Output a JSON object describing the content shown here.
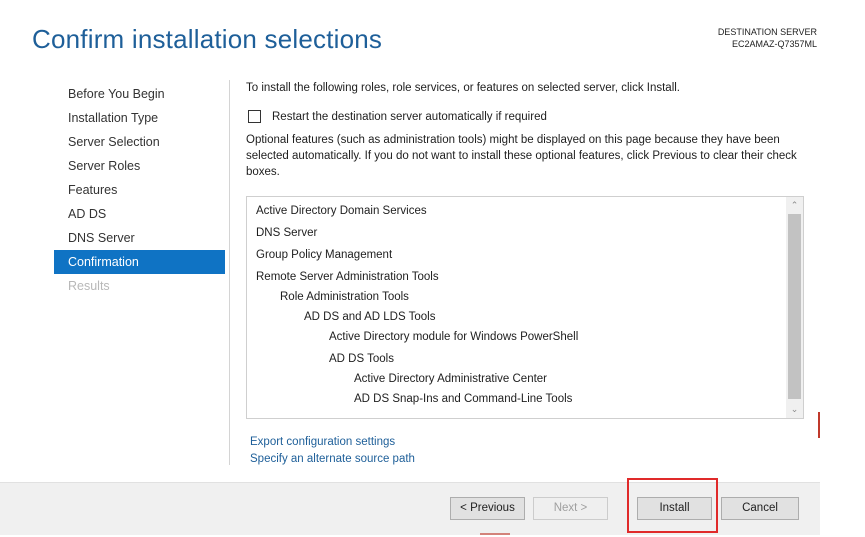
{
  "header": {
    "title": "Confirm installation selections",
    "destination_label": "DESTINATION SERVER",
    "destination_server": "EC2AMAZ-Q7357ML"
  },
  "nav": {
    "items": [
      {
        "label": "Before You Begin",
        "state": "normal"
      },
      {
        "label": "Installation Type",
        "state": "normal"
      },
      {
        "label": "Server Selection",
        "state": "normal"
      },
      {
        "label": "Server Roles",
        "state": "normal"
      },
      {
        "label": "Features",
        "state": "normal"
      },
      {
        "label": "AD DS",
        "state": "normal"
      },
      {
        "label": "DNS Server",
        "state": "normal"
      },
      {
        "label": "Confirmation",
        "state": "active"
      },
      {
        "label": "Results",
        "state": "disabled"
      }
    ]
  },
  "main": {
    "intro": "To install the following roles, role services, or features on selected server, click Install.",
    "restart_label": "Restart the destination server automatically if required",
    "restart_checked": false,
    "optional_text": "Optional features (such as administration tools) might be displayed on this page because they have been selected automatically. If you do not want to install these optional features, click Previous to clear their check boxes.",
    "features": [
      "Active Directory Domain Services",
      "DNS Server",
      "Group Policy Management",
      "Remote Server Administration Tools",
      "Role Administration Tools",
      "AD DS and AD LDS Tools",
      "Active Directory module for Windows PowerShell",
      "AD DS Tools",
      "Active Directory Administrative Center",
      "AD DS Snap-Ins and Command-Line Tools"
    ],
    "export_link": "Export configuration settings",
    "alternate_source_link": "Specify an alternate source path"
  },
  "footer": {
    "previous": "< Previous",
    "next": "Next >",
    "install": "Install",
    "cancel": "Cancel"
  },
  "colors": {
    "accent": "#0f73c4",
    "title": "#1e5f99",
    "highlight": "#e02a2a"
  }
}
